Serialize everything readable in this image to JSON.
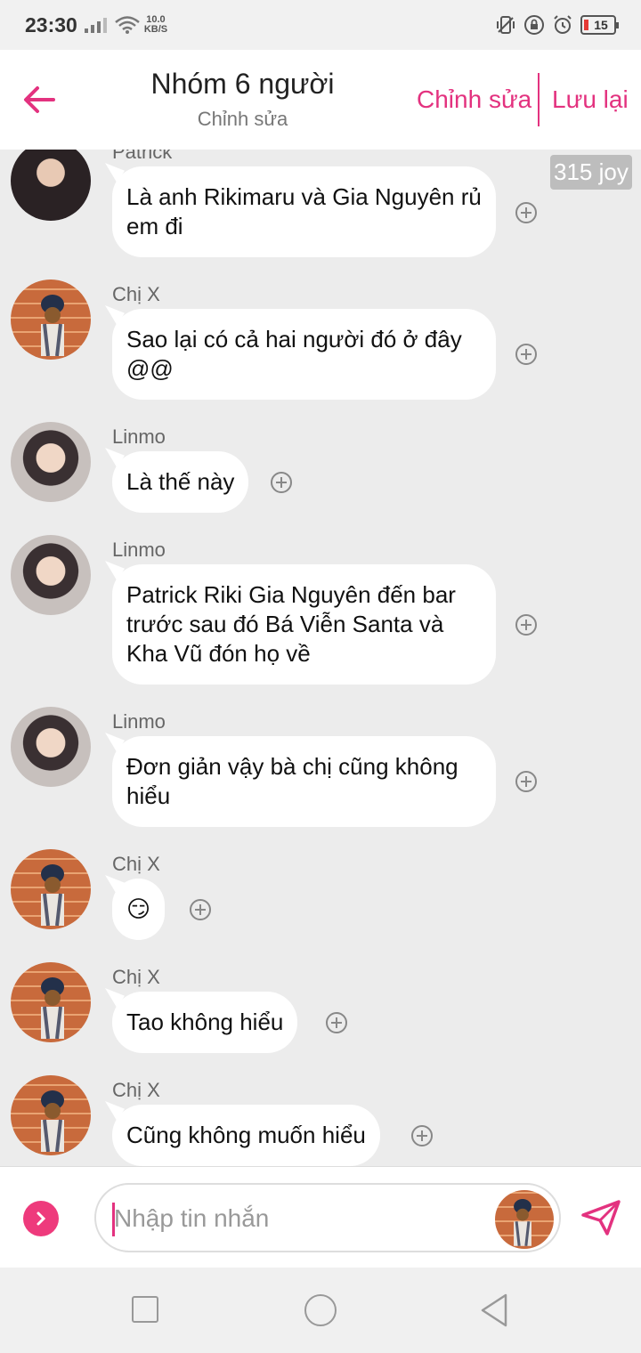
{
  "status_bar": {
    "time": "23:30",
    "net_speed_value": "10.0",
    "net_speed_unit": "KB/S",
    "battery": "15",
    "icons": [
      "signal-icon",
      "wifi-icon",
      "vibrate-icon",
      "lock-rotation-icon",
      "alarm-icon",
      "battery-icon"
    ]
  },
  "header": {
    "title": "Nhóm 6 người",
    "subtitle": "Chỉnh sửa",
    "edit_label": "Chỉnh sửa",
    "save_label": "Lưu lại",
    "accent_color": "#e3327f"
  },
  "badge": {
    "text": "315 joy"
  },
  "messages": [
    {
      "sender": "Patrick",
      "text": "Là anh Rikimaru và Gia Nguyên rủ em đi",
      "avatar": "patrick"
    },
    {
      "sender": "Chị X",
      "text": "Sao lại có cả hai người đó ở đây @@",
      "avatar": "chi-x"
    },
    {
      "sender": "Linmo",
      "text": "Là thế này",
      "avatar": "linmo"
    },
    {
      "sender": "Linmo",
      "text": "Patrick Riki Gia Nguyên đến bar trước sau đó Bá Viễn Santa và Kha Vũ đón họ về",
      "avatar": "linmo"
    },
    {
      "sender": "Linmo",
      "text": "Đơn giản vậy bà chị cũng không hiểu",
      "avatar": "linmo"
    },
    {
      "sender": "Chị X",
      "text": "😏",
      "avatar": "chi-x"
    },
    {
      "sender": "Chị X",
      "text": "Tao không hiểu",
      "avatar": "chi-x"
    },
    {
      "sender": "Chị X",
      "text": "Cũng không muốn hiểu",
      "avatar": "chi-x"
    }
  ],
  "input": {
    "placeholder": "Nhập tin nhắn",
    "value": ""
  }
}
